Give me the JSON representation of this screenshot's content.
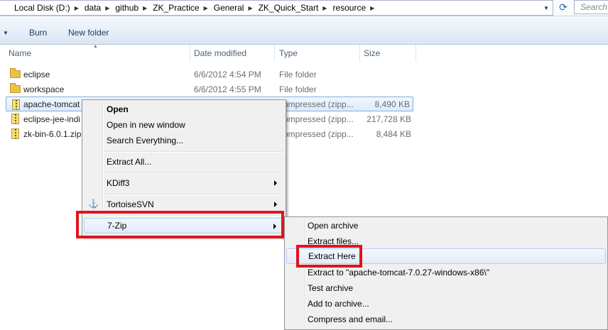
{
  "address": {
    "crumbs": [
      "Local Disk (D:)",
      "data",
      "github",
      "ZK_Practice",
      "General",
      "ZK_Quick_Start",
      "resource"
    ],
    "search_placeholder": "Search"
  },
  "toolbar": {
    "burn": "Burn",
    "new_folder": "New folder"
  },
  "columns": {
    "name": "Name",
    "date": "Date modified",
    "type": "Type",
    "size": "Size"
  },
  "files": [
    {
      "name": "eclipse",
      "date": "6/6/2012 4:54 PM",
      "type": "File folder",
      "size": "",
      "icon": "folder-icon"
    },
    {
      "name": "workspace",
      "date": "6/6/2012 4:55 PM",
      "type": "File folder",
      "size": "",
      "icon": "folder-icon"
    },
    {
      "name": "apache-tomcat",
      "date": "",
      "type": "ompressed (zipp...",
      "size": "8,490 KB",
      "icon": "zip-icon",
      "selected": true
    },
    {
      "name": "eclipse-jee-indi",
      "date": "",
      "type": "ompressed (zipp...",
      "size": "217,728 KB",
      "icon": "zip-icon"
    },
    {
      "name": "zk-bin-6.0.1.zip",
      "date": "",
      "type": "ompressed (zipp...",
      "size": "8,484 KB",
      "icon": "zip-icon"
    }
  ],
  "context_menu": {
    "open": "Open",
    "open_new_window": "Open in new window",
    "search_everything": "Search Everything...",
    "extract_all": "Extract All...",
    "kdiff3": "KDiff3",
    "tortoisesvn": "TortoiseSVN",
    "sevenzip": "7-Zip"
  },
  "submenu": {
    "open_archive": "Open archive",
    "extract_files": "Extract files...",
    "extract_here": "Extract Here",
    "extract_to": "Extract to \"apache-tomcat-7.0.27-windows-x86\\\"",
    "test_archive": "Test archive",
    "add_to_archive": "Add to archive...",
    "compress_email": "Compress and email..."
  },
  "colors": {
    "highlight_red": "#e0141e",
    "selection_blue": "#dcebfc"
  }
}
